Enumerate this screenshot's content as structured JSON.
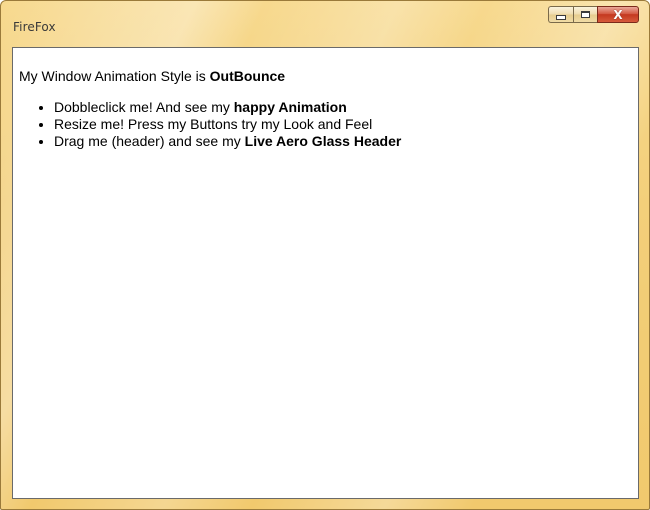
{
  "window": {
    "title": "FireFox",
    "controls": {
      "minimize_icon": "minimize-icon",
      "maximize_icon": "maximize-icon",
      "close_icon": "close-icon",
      "close_glyph": "X"
    },
    "colors": {
      "frame": "#f3cf7a",
      "close": "#c4381f"
    }
  },
  "content": {
    "intro_prefix": "My Window Animation Style is ",
    "intro_value": "OutBounce",
    "items": [
      {
        "text": "Dobbleclick me! And see my ",
        "bold": "happy Animation"
      },
      {
        "text": "Resize me! Press my Buttons try my Look and Feel",
        "bold": ""
      },
      {
        "text": "Drag me (header) and see my ",
        "bold": "Live Aero Glass Header"
      }
    ]
  }
}
